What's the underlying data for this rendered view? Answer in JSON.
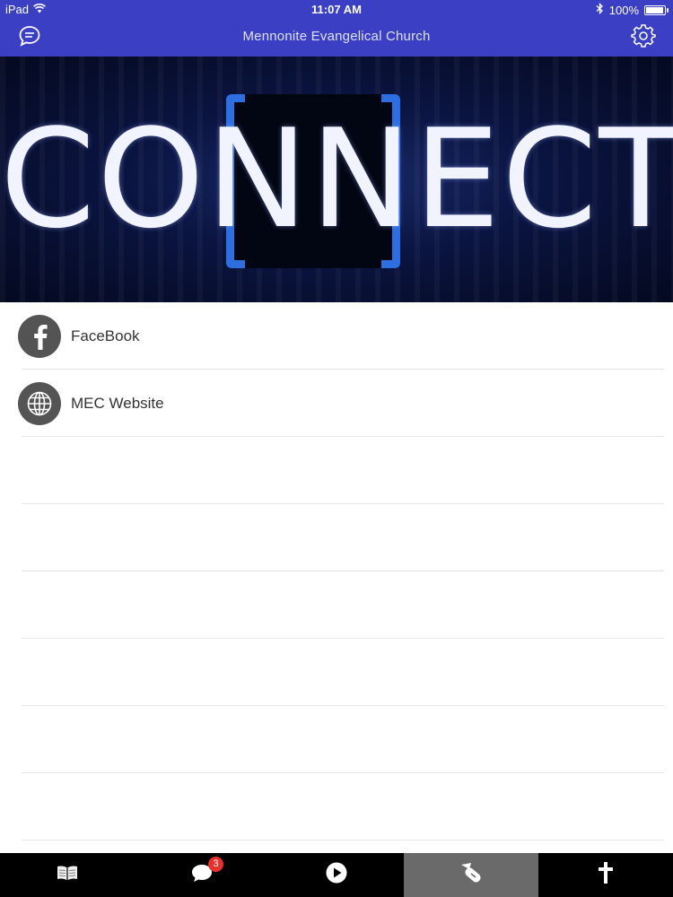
{
  "status_bar": {
    "device": "iPad",
    "time": "11:07 AM",
    "battery": "100%",
    "battery_level": 1.0
  },
  "nav": {
    "title": "Mennonite Evangelical Church",
    "left_icon": "chat-bubble-icon",
    "right_icon": "gear-icon"
  },
  "banner": {
    "text": "CONNECT",
    "accent_color": "#2d6fe0"
  },
  "list": {
    "items": [
      {
        "label": "FaceBook",
        "icon": "facebook-icon"
      },
      {
        "label": "MEC Website",
        "icon": "globe-icon"
      }
    ]
  },
  "tabbar": {
    "tabs": [
      {
        "icon": "book-icon"
      },
      {
        "icon": "messages-icon",
        "badge": "3"
      },
      {
        "icon": "play-icon"
      },
      {
        "icon": "connect-icon",
        "active": true
      },
      {
        "icon": "cross-icon"
      }
    ]
  },
  "colors": {
    "nav_background": "#3a3fc4",
    "icon_circle": "#545454",
    "badge": "#e8302c"
  }
}
